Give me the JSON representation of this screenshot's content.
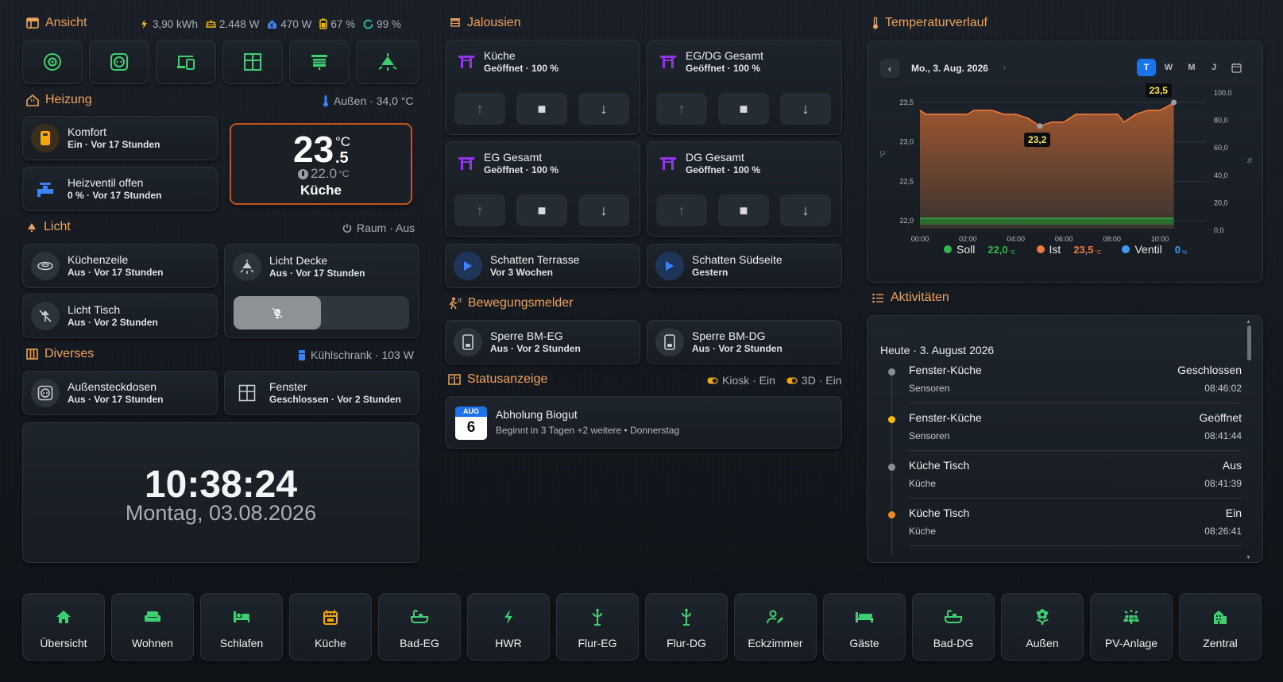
{
  "ansicht": {
    "title": "Ansicht",
    "stats": [
      {
        "icon": "solar-icon",
        "value": "3,90 kWh",
        "color": "#f5b800"
      },
      {
        "icon": "solar-panel-icon",
        "value": "2.448 W",
        "color": "#f5b800"
      },
      {
        "icon": "home-power-icon",
        "value": "470 W",
        "color": "#3b82f6"
      },
      {
        "icon": "battery-icon",
        "value": "67 %",
        "color": "#f5b800"
      },
      {
        "icon": "ring-icon",
        "value": "99 %",
        "color": "#1fb5a8"
      }
    ]
  },
  "heizung": {
    "title": "Heizung",
    "aussen": "Außen · 34,0 °C",
    "komfort": {
      "name": "Komfort",
      "state": "Ein · Vor 17 Stunden"
    },
    "ventil": {
      "name": "Heizventil offen",
      "state": "0 % · Vor 17 Stunden"
    },
    "thermo": {
      "temp": "23",
      "unit": "°C",
      "decimal": ".5",
      "target": "22.0",
      "target_unit": "°C",
      "room": "Küche"
    }
  },
  "licht": {
    "title": "Licht",
    "raum": "Raum · Aus",
    "kuechenzeile": {
      "name": "Küchenzeile",
      "state": "Aus · Vor 17 Stunden"
    },
    "tisch": {
      "name": "Licht Tisch",
      "state": "Aus · Vor 2 Stunden"
    },
    "decke": {
      "name": "Licht Decke",
      "state": "Aus · Vor 17 Stunden"
    }
  },
  "diverses": {
    "title": "Diverses",
    "kuehl": "Kühlschrank · 103 W",
    "steck": {
      "name": "Außensteckdosen",
      "state": "Aus · Vor 17 Stunden"
    },
    "fenster": {
      "name": "Fenster",
      "state": "Geschlossen · Vor 2 Stunden"
    }
  },
  "clock": {
    "time": "10:38:24",
    "date": "Montag, 03.08.2026"
  },
  "jalousien": {
    "title": "Jalousien",
    "items": [
      {
        "name": "Küche",
        "state": "Geöffnet · 100 %"
      },
      {
        "name": "EG/DG Gesamt",
        "state": "Geöffnet · 100 %"
      },
      {
        "name": "EG Gesamt",
        "state": "Geöffnet · 100 %"
      },
      {
        "name": "DG Gesamt",
        "state": "Geöffnet · 100 %"
      }
    ],
    "scenes": [
      {
        "name": "Schatten Terrasse",
        "state": "Vor 3 Wochen"
      },
      {
        "name": "Schatten Südseite",
        "state": "Gestern"
      }
    ]
  },
  "bewegung": {
    "title": "Bewegungsmelder",
    "items": [
      {
        "name": "Sperre BM-EG",
        "state": "Aus · Vor 2 Stunden"
      },
      {
        "name": "Sperre BM-DG",
        "state": "Aus · Vor 2 Stunden"
      }
    ]
  },
  "status": {
    "title": "Statusanzeige",
    "kiosk": "Kiosk · Ein",
    "d3": "3D · Ein",
    "event": {
      "month": "AUG",
      "day": "6",
      "title": "Abholung Biogut",
      "sub": "Beginnt in 3 Tagen +2 weitere • Donnerstag"
    }
  },
  "temp": {
    "title": "Temperaturverlauf",
    "date": "Mo., 3. Aug. 2026",
    "ranges": [
      "T",
      "W",
      "M",
      "J"
    ],
    "callout_max": "23,5",
    "callout_min": "23,2",
    "yleft": [
      "23,5",
      "23,0",
      "22,5",
      "22,0"
    ],
    "yright": [
      "100,0",
      "80,0",
      "60,0",
      "40,0",
      "20,0",
      "0,0"
    ],
    "xticks": [
      "00:00",
      "02:00",
      "04:00",
      "06:00",
      "08:00",
      "10:00"
    ],
    "left_axis_unit": "°C",
    "right_axis_unit": "%",
    "legend": [
      {
        "name": "Soll",
        "value": "22,0",
        "unit": "°C",
        "color": "#2fb84a"
      },
      {
        "name": "Ist",
        "value": "23,5",
        "unit": "°C",
        "color": "#f07a3c"
      },
      {
        "name": "Ventil",
        "value": "0",
        "unit": "%",
        "color": "#3b9cf2"
      }
    ]
  },
  "chart_data": {
    "type": "area",
    "title": "",
    "x": [
      "00:00",
      "00:15",
      "00:30",
      "01:00",
      "01:30",
      "02:00",
      "02:15",
      "02:30",
      "02:45",
      "03:00",
      "03:30",
      "04:00",
      "04:30",
      "04:45",
      "05:00",
      "05:30",
      "06:00",
      "06:30",
      "07:00",
      "07:30",
      "08:00",
      "08:15",
      "08:30",
      "09:00",
      "09:30",
      "10:00",
      "10:20",
      "10:35"
    ],
    "series": [
      {
        "name": "Ist",
        "values": [
          23.4,
          23.35,
          23.35,
          23.35,
          23.35,
          23.35,
          23.4,
          23.4,
          23.4,
          23.4,
          23.35,
          23.35,
          23.3,
          23.25,
          23.2,
          23.25,
          23.25,
          23.35,
          23.35,
          23.35,
          23.35,
          23.35,
          23.25,
          23.35,
          23.4,
          23.4,
          23.45,
          23.5
        ]
      },
      {
        "name": "Soll",
        "values": [
          22.0,
          22.0,
          22.0,
          22.0,
          22.0,
          22.0,
          22.0,
          22.0,
          22.0,
          22.0,
          22.0,
          22.0,
          22.0,
          22.0,
          22.0,
          22.0,
          22.0,
          22.0,
          22.0,
          22.0,
          22.0,
          22.0,
          22.0,
          22.0,
          22.0,
          22.0,
          22.0,
          22.0
        ]
      },
      {
        "name": "Ventil",
        "values": [
          0,
          0,
          0,
          0,
          0,
          0,
          0,
          0,
          0,
          0,
          0,
          0,
          0,
          0,
          0,
          0,
          0,
          0,
          0,
          0,
          0,
          0,
          0,
          0,
          0,
          0,
          0,
          0
        ]
      }
    ],
    "ylim": [
      21.9,
      23.6
    ],
    "ylim_right": [
      0,
      100
    ]
  },
  "aktivitaeten": {
    "title": "Aktivitäten",
    "day": "Heute · 3. August 2026",
    "items": [
      {
        "name": "Fenster-Küche",
        "area": "Sensoren",
        "state": "Geschlossen",
        "time": "08:46:02",
        "dot": "#8a8f95"
      },
      {
        "name": "Fenster-Küche",
        "area": "Sensoren",
        "state": "Geöffnet",
        "time": "08:41:44",
        "dot": "#f5b800"
      },
      {
        "name": "Küche Tisch",
        "area": "Küche",
        "state": "Aus",
        "time": "08:41:39",
        "dot": "#8a8f95"
      },
      {
        "name": "Küche Tisch",
        "area": "Küche",
        "state": "Ein",
        "time": "08:26:41",
        "dot": "#f08a1c"
      }
    ]
  },
  "nav": [
    {
      "label": "Übersicht",
      "icon": "home-icon"
    },
    {
      "label": "Wohnen",
      "icon": "sofa-icon"
    },
    {
      "label": "Schlafen",
      "icon": "bed-icon"
    },
    {
      "label": "Küche",
      "icon": "stove-icon"
    },
    {
      "label": "Bad-EG",
      "icon": "bathtub-icon"
    },
    {
      "label": "HWR",
      "icon": "bolt-icon"
    },
    {
      "label": "Flur-EG",
      "icon": "coat-hanger-icon"
    },
    {
      "label": "Flur-DG",
      "icon": "coat-hanger-icon"
    },
    {
      "label": "Eckzimmer",
      "icon": "person-edit-icon"
    },
    {
      "label": "Gäste",
      "icon": "guest-bed-icon"
    },
    {
      "label": "Bad-DG",
      "icon": "bathtub-icon"
    },
    {
      "label": "Außen",
      "icon": "flower-icon"
    },
    {
      "label": "PV-Anlage",
      "icon": "solar-panel-icon"
    },
    {
      "label": "Zentral",
      "icon": "building-icon"
    }
  ]
}
